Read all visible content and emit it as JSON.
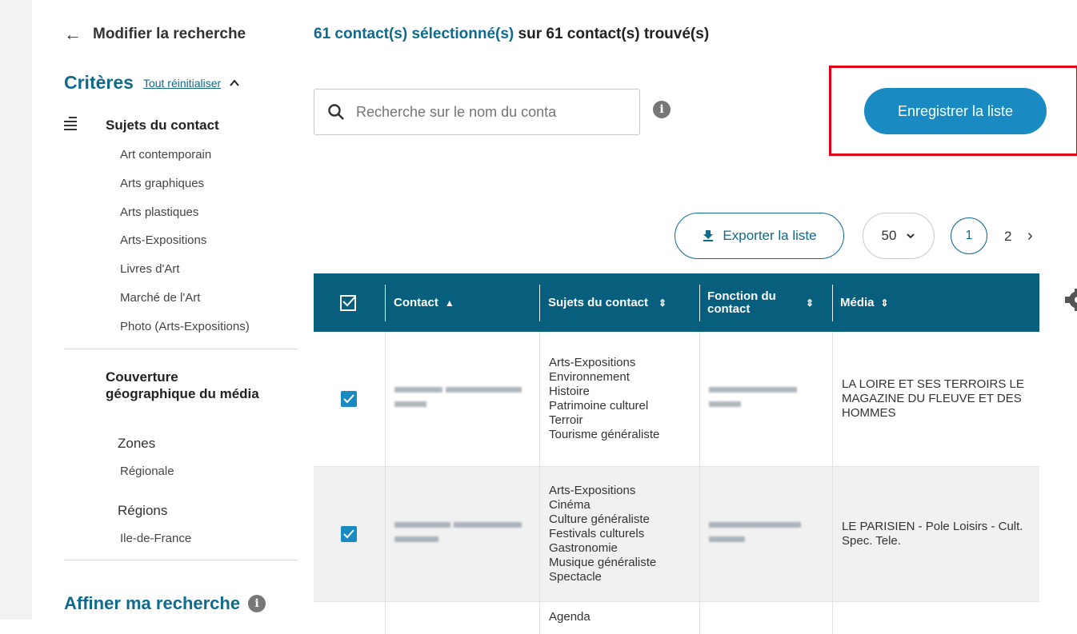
{
  "sidebar": {
    "back_label": "Modifier la recherche",
    "criteres_title": "Critères",
    "reset_label": "Tout réinitialiser",
    "subjects_title": "Sujets du contact",
    "subjects": [
      "Art contemporain",
      "Arts graphiques",
      "Arts plastiques",
      "Arts-Expositions",
      "Livres d'Art",
      "Marché de l'Art",
      "Photo (Arts-Expositions)"
    ],
    "coverage_title": "Couverture géographique du média",
    "zones_label": "Zones",
    "zones_value": "Régionale",
    "regions_label": "Régions",
    "regions_value": "Ile-de-France",
    "affiner_label": "Affiner ma recherche"
  },
  "main": {
    "count_selected": "61 contact(s) sélectionné(s)",
    "count_found": " sur 61 contact(s) trouvé(s)",
    "search_placeholder": "Recherche sur le nom du conta",
    "save_label": "Enregistrer la liste",
    "export_label": "Exporter la liste",
    "per_page": "50",
    "pages": [
      "1",
      "2"
    ],
    "columns": [
      "Contact",
      "Sujets du contact",
      "Fonction du contact",
      "Média"
    ],
    "rows": [
      {
        "subjects": [
          "Arts-Expositions",
          "Environnement",
          "Histoire",
          "Patrimoine culturel",
          "Terroir",
          "Tourisme généraliste"
        ],
        "media": "LA LOIRE ET SES TERROIRS LE MAGAZINE DU FLEUVE ET DES HOMMES"
      },
      {
        "subjects": [
          "Arts-Expositions",
          "Cinéma",
          "Culture généraliste",
          "Festivals culturels",
          "Gastronomie",
          "Musique généraliste",
          "Spectacle"
        ],
        "media": "LE PARISIEN - Pole Loisirs - Cult. Spec. Tele."
      },
      {
        "subjects": [
          "Agenda"
        ],
        "media": ""
      }
    ]
  },
  "icons": {
    "info": "i"
  },
  "colors": {
    "accent": "#0f6a8c",
    "header": "#075e7d",
    "button": "#1a8ac3",
    "highlight": "#e1001a"
  }
}
